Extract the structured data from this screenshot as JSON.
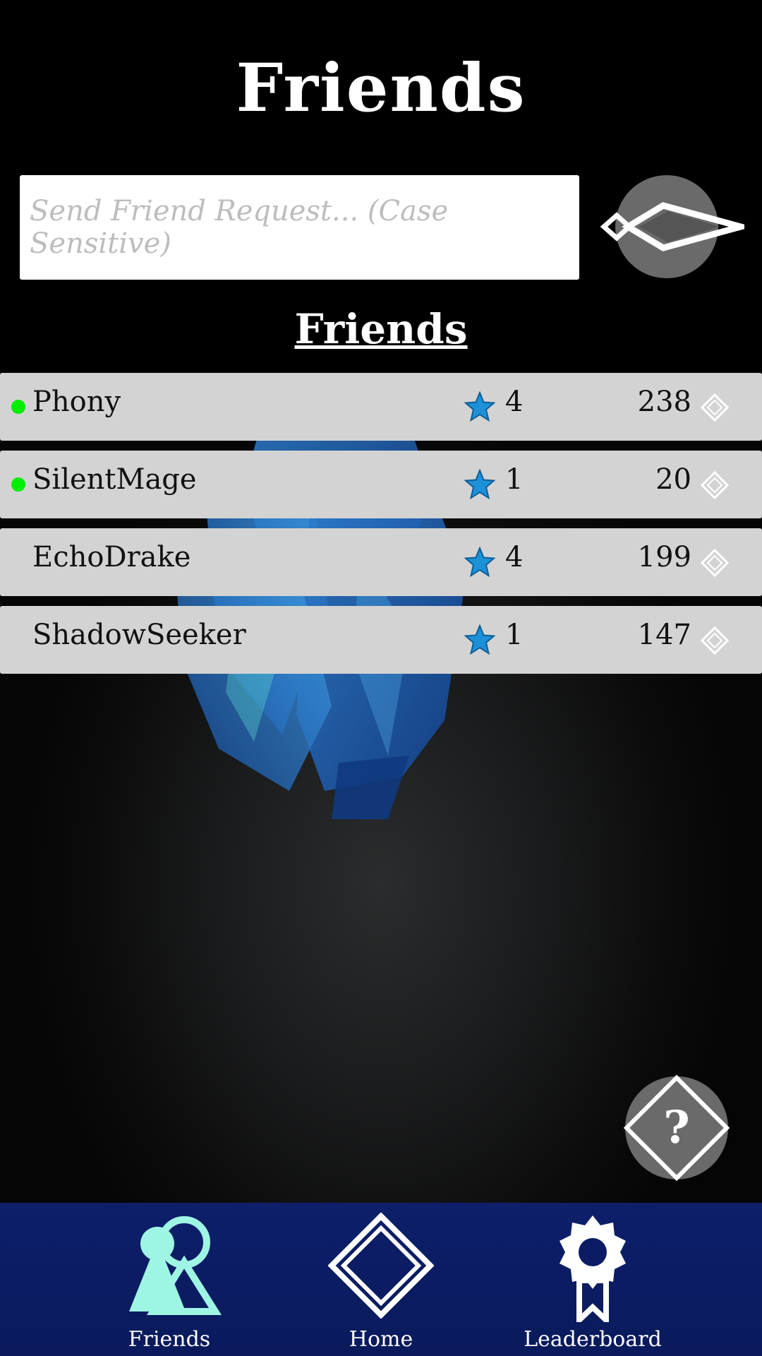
{
  "header": {
    "title": "Friends"
  },
  "search": {
    "placeholder": "Send Friend Request... (Case Sensitive)"
  },
  "section": {
    "title": "Friends"
  },
  "friends": [
    {
      "name": "Phony",
      "online": true,
      "level": "4",
      "score": "238"
    },
    {
      "name": "SilentMage",
      "online": true,
      "level": "1",
      "score": "20"
    },
    {
      "name": "EchoDrake",
      "online": false,
      "level": "4",
      "score": "199"
    },
    {
      "name": "ShadowSeeker",
      "online": false,
      "level": "1",
      "score": "147"
    }
  ],
  "help": {
    "glyph": "?"
  },
  "nav": {
    "friends_label": "Friends",
    "home_label": "Home",
    "leaderboard_label": "Leaderboard"
  },
  "colors": {
    "online_dot": "#00ee00",
    "row_bg": "#d3d3d3",
    "nav_bg": "#0b1c63",
    "nav_active": "#9ff5e3",
    "star_blue": "#1e90d8"
  },
  "icons": {
    "send": "send-diamond-arrow-icon",
    "star": "star-icon",
    "gem": "gem-icon",
    "help": "help-icon",
    "friends": "friends-people-icon",
    "home": "home-diamond-icon",
    "leaderboard": "ribbon-badge-icon"
  }
}
